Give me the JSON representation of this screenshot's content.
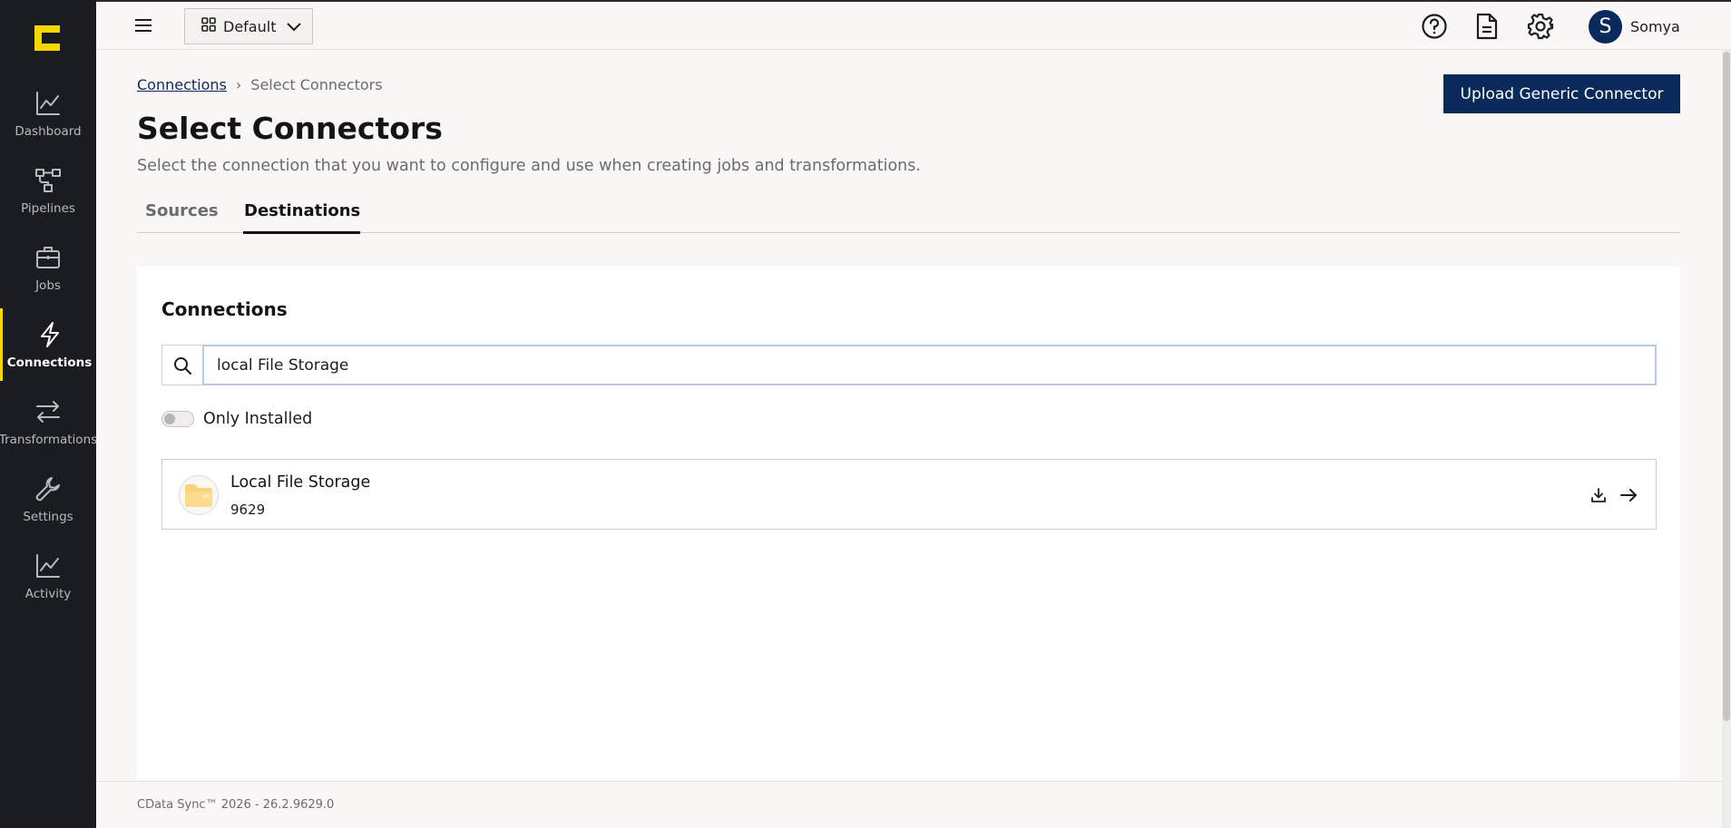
{
  "sidebar": {
    "items": [
      {
        "label": "Dashboard",
        "icon": "chart-line-icon"
      },
      {
        "label": "Pipelines",
        "icon": "pipeline-icon"
      },
      {
        "label": "Jobs",
        "icon": "briefcase-icon"
      },
      {
        "label": "Connections",
        "icon": "lightning-icon",
        "active": true
      },
      {
        "label": "Transformations",
        "icon": "arrows-swap-icon"
      },
      {
        "label": "Settings",
        "icon": "wrench-icon"
      },
      {
        "label": "Activity",
        "icon": "chart-line-icon"
      }
    ]
  },
  "topbar": {
    "workspace_label": "Default",
    "user_initial": "S",
    "user_name": "Somya"
  },
  "breadcrumb": {
    "parent": "Connections",
    "separator": "›",
    "current": "Select Connectors"
  },
  "header": {
    "title": "Select Connectors",
    "description": "Select the connection that you want to configure and use when creating jobs and transformations.",
    "upload_button": "Upload Generic Connector"
  },
  "tabs": [
    {
      "label": "Sources",
      "active": false
    },
    {
      "label": "Destinations",
      "active": true
    }
  ],
  "card": {
    "title": "Connections",
    "search_value": "local File Storage",
    "toggle_label": "Only Installed",
    "toggle_on": false
  },
  "results": [
    {
      "name": "Local File Storage",
      "version": "9629",
      "icon": "folder-icon"
    }
  ],
  "footer": {
    "text": "CData Sync™ 2026 - 26.2.9629.0"
  },
  "colors": {
    "sidebar_bg": "#1b1c22",
    "brand_yellow": "#f5d700",
    "primary_navy": "#0b2a5c",
    "page_bg": "#f8f7f5"
  }
}
